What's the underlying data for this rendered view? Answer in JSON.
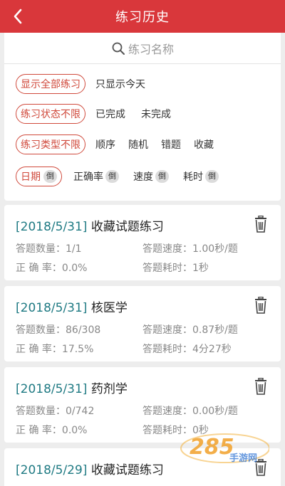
{
  "header": {
    "title": "练习历史"
  },
  "search": {
    "placeholder": "练习名称"
  },
  "filters": {
    "scope": {
      "selected": "显示全部练习",
      "options": [
        "只显示今天"
      ]
    },
    "status": {
      "selected": "练习状态不限",
      "options": [
        "已完成",
        "未完成"
      ]
    },
    "type": {
      "selected": "练习类型不限",
      "options": [
        "顺序",
        "随机",
        "错题",
        "收藏"
      ]
    },
    "sort": {
      "selected": {
        "label": "日期",
        "badge": "倒"
      },
      "options": [
        {
          "label": "正确率",
          "badge": "倒"
        },
        {
          "label": "速度",
          "badge": "倒"
        },
        {
          "label": "耗时",
          "badge": "倒"
        }
      ]
    }
  },
  "labels": {
    "count": "答题数量：",
    "speed": "答题速度：",
    "accuracy": "正 确 率：",
    "time": "答题耗时："
  },
  "records": [
    {
      "date": "[2018/5/31]",
      "name": "收藏试题练习",
      "count": "1/1",
      "speed": "1.00秒/题",
      "accuracy": "0.0%",
      "time": "1秒"
    },
    {
      "date": "[2018/5/31]",
      "name": "核医学",
      "count": "86/308",
      "speed": "0.87秒/题",
      "accuracy": "17.5%",
      "time": "4分27秒"
    },
    {
      "date": "[2018/5/31]",
      "name": "药剂学",
      "count": "0/742",
      "speed": "0.00秒/题",
      "accuracy": "0.0%",
      "time": "0秒"
    },
    {
      "date": "[2018/5/29]",
      "name": "收藏试题练习"
    }
  ],
  "watermark": {
    "text": "285",
    "sub": "手游网"
  },
  "colors": {
    "header": "#d9373b",
    "accent": "#d04a3c",
    "date": "#1f7a83"
  }
}
